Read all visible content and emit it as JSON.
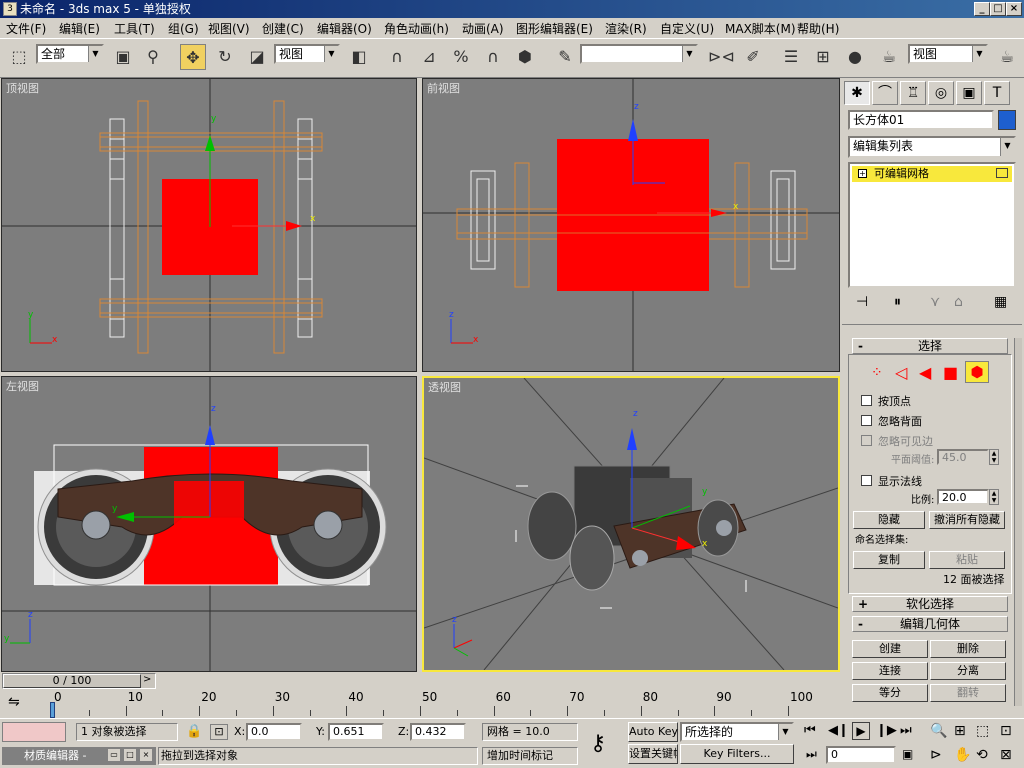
{
  "window": {
    "title": "未命名 - 3ds max 5 - 单独授权",
    "app_icon": "3ds-max-icon"
  },
  "menu": [
    "文件(F)",
    "编辑(E)",
    "工具(T)",
    "组(G)",
    "视图(V)",
    "创建(C)",
    "编辑器(O)",
    "角色动画(h)",
    "动画(A)",
    "图形编辑器(E)",
    "渲染(R)",
    "自定义(U)",
    "MAX脚本(M)",
    "帮助(H)"
  ],
  "toolbar": {
    "selection_filter": "全部",
    "reference_coord": "视图",
    "named_selection": "",
    "right_coord": "视图"
  },
  "viewports": {
    "top": "顶视图",
    "front": "前视图",
    "left": "左视图",
    "perspective": "透视图"
  },
  "axis_labels": {
    "x": "x",
    "y": "y",
    "z": "z"
  },
  "colors": {
    "accent_red": "#ff0000",
    "wire_orange": "#d88838",
    "active_border": "#f8e83c",
    "title_blue": "#0a246a",
    "viewport_bg": "#7d7d7d"
  },
  "command_panel": {
    "object_name": "长方体01",
    "object_color": "#1e5fcf",
    "modifier_list": "编辑集列表",
    "stack_item": "可编辑网格",
    "rollouts": {
      "selection": "选择",
      "soft_selection": "软化选择",
      "edit_geometry": "编辑几何体"
    },
    "selection": {
      "by_vertex": "按顶点",
      "ignore_backface": "忽略背面",
      "ignore_visible_edges": "忽略可见边",
      "planar_threshold_label": "平面阈值:",
      "planar_threshold": "45.0",
      "show_normals": "显示法线",
      "scale_label": "比例:",
      "scale": "20.0",
      "hide": "隐藏",
      "unhide_all": "撤消所有隐藏",
      "named_sel_label": "命名选择集:",
      "copy": "复制",
      "paste": "粘贴",
      "status": "12 面被选择"
    },
    "edit_geometry": {
      "create": "创建",
      "delete": "删除",
      "attach": "连接",
      "detach": "分离",
      "divide": "等分",
      "turn": "翻转"
    }
  },
  "timeline": {
    "frame_display": "0 / 100",
    "ticks": [
      "0",
      "10",
      "20",
      "30",
      "40",
      "50",
      "60",
      "70",
      "80",
      "90",
      "100"
    ]
  },
  "status": {
    "selected": "1 对象被选择",
    "x_label": "X:",
    "x": "0.0",
    "y_label": "Y:",
    "y": "0.651",
    "z_label": "Z:",
    "z": "0.432",
    "grid": "网格 = 10.0",
    "prompt": "拖拉到选择对象",
    "add_time_tag": "增加时间标记",
    "autokey": "Auto Key",
    "set_key": "设置关键帧",
    "key_mode": "所选择的",
    "key_filters": "Key Filters...",
    "frame": "0",
    "mat_editor_task": "材质编辑器 -"
  }
}
